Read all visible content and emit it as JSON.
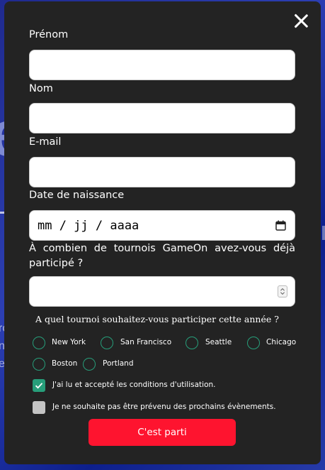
{
  "background": {
    "glyph_big": "e",
    "glyph_small": [
      "ro",
      "n",
      "e"
    ]
  },
  "form": {
    "close_icon": "close-icon",
    "first_name": {
      "label": "Prénom",
      "value": ""
    },
    "last_name": {
      "label": "Nom",
      "value": ""
    },
    "email": {
      "label": "E-mail",
      "value": ""
    },
    "birthdate": {
      "label": "Date de naissance",
      "placeholder": "mm / jj / aaaa",
      "icon": "calendar-icon"
    },
    "tournaments_count": {
      "label": "À combien de tournois GameOn avez-vous déjà participé ?",
      "value": "",
      "icon": "spinner-icon"
    },
    "location_question": "A quel tournoi souhaitez-vous participer cette année ?",
    "locations": [
      "New York",
      "San Francisco",
      "Seattle",
      "Chicago",
      "Boston",
      "Portland"
    ],
    "terms": {
      "label": "J'ai lu et accepté les conditions d'utilisation.",
      "checked": true
    },
    "newsletter": {
      "label": "Je ne souhaite pas être prévenu des prochains évènements.",
      "checked": false
    },
    "submit_label": "C'est parti"
  },
  "colors": {
    "accent": "#279e7a",
    "submit": "#fe142f",
    "modal_bg": "#232323"
  }
}
